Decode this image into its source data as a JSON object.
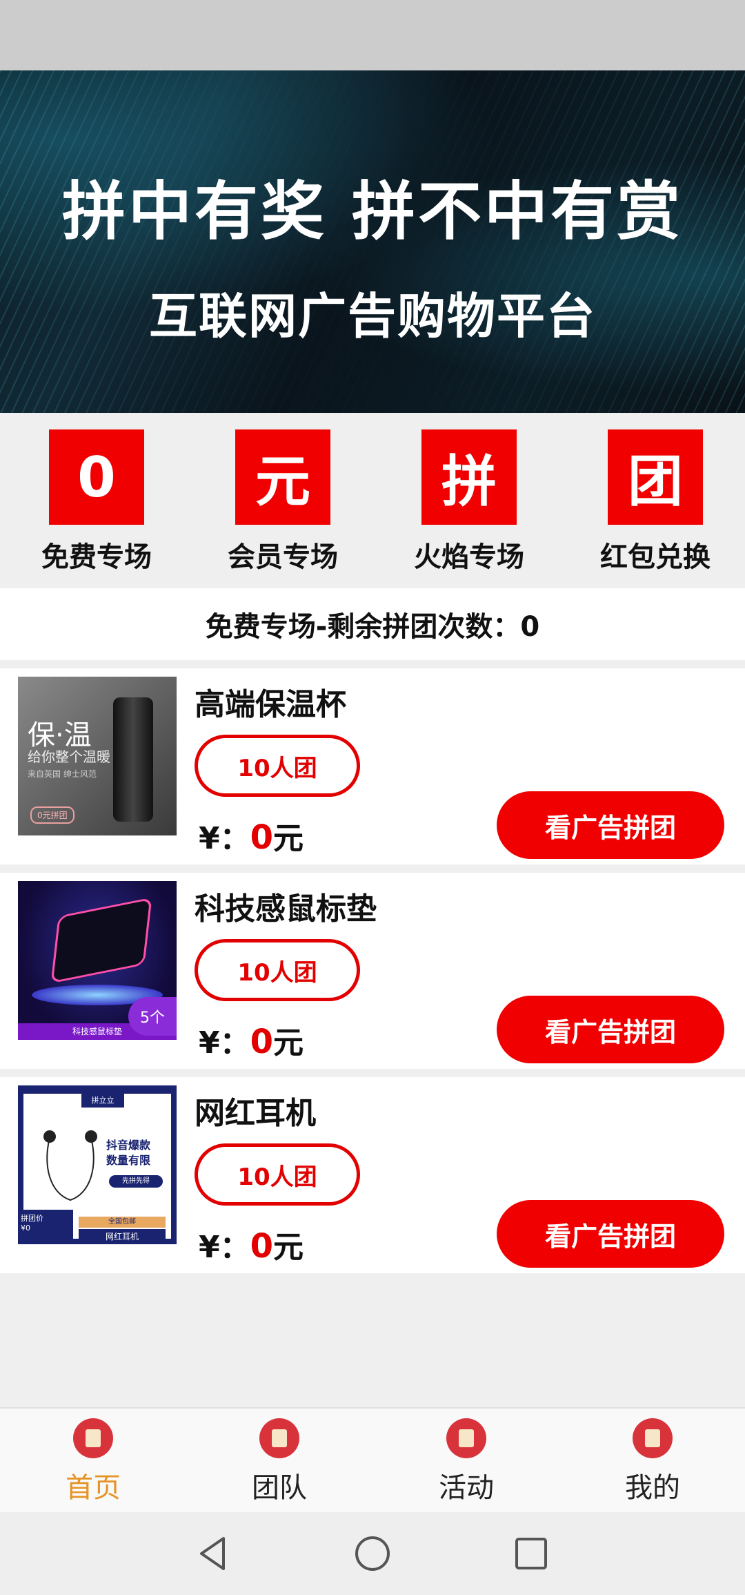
{
  "banner": {
    "title": "拼中有奖  拼不中有赏",
    "subtitle": "互联网广告购物平台",
    "slide_count": 3,
    "active_slide": 3
  },
  "categories": [
    {
      "glyph": "0",
      "label": "免费专场"
    },
    {
      "glyph": "元",
      "label": "会员专场"
    },
    {
      "glyph": "拼",
      "label": "火焰专场"
    },
    {
      "glyph": "团",
      "label": "红包兑换"
    }
  ],
  "notice": "免费专场-剩余拼团次数：0",
  "products": [
    {
      "name": "高端保温杯",
      "group_tag": "10人团",
      "currency": "¥：",
      "price": "0",
      "unit": "元",
      "cta": "看广告拼团",
      "thumb": {
        "line1": "保·温",
        "line2": "给你整个温暖",
        "line3": "来自英国 绅士风范",
        "badge": "0元拼团"
      }
    },
    {
      "name": "科技感鼠标垫",
      "group_tag": "10人团",
      "currency": "¥：",
      "price": "0",
      "unit": "元",
      "cta": "看广告拼团",
      "thumb": {
        "strip": "科技感鼠标垫",
        "count": "5个"
      }
    },
    {
      "name": "网红耳机",
      "group_tag": "10人团",
      "currency": "¥：",
      "price": "0",
      "unit": "元",
      "cta": "看广告拼团",
      "thumb": {
        "top": "拼立立",
        "headline1": "抖音爆款",
        "headline2": "数量有限",
        "button": "先拼先得",
        "price_label": "拼团价",
        "price": "¥0",
        "shipping": "全国包邮",
        "name": "网红耳机"
      }
    }
  ],
  "tabs": [
    {
      "label": "首页",
      "icon": "home-icon",
      "active": true
    },
    {
      "label": "团队",
      "icon": "team-icon",
      "active": false
    },
    {
      "label": "活动",
      "icon": "activity-icon",
      "active": false
    },
    {
      "label": "我的",
      "icon": "profile-icon",
      "active": false
    }
  ],
  "colors": {
    "brand_red": "#f00000",
    "active_tab": "#e59324",
    "dot_active": "#13b98d"
  }
}
